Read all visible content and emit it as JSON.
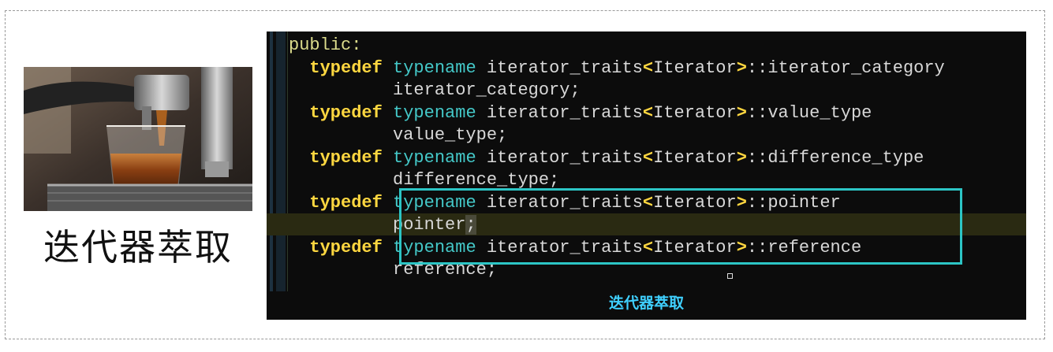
{
  "left_panel": {
    "photo_icon": "espresso-machine-photo",
    "title": "迭代器萃取"
  },
  "editor": {
    "lines": [
      [
        {
          "t": "public:",
          "c": "pub"
        }
      ],
      [
        {
          "t": "  ",
          "c": "id"
        },
        {
          "t": "typedef",
          "c": "kw"
        },
        {
          "t": " ",
          "c": "id"
        },
        {
          "t": "typename",
          "c": "tn"
        },
        {
          "t": " iterator_traits",
          "c": "id"
        },
        {
          "t": "<",
          "c": "br"
        },
        {
          "t": "Iterator",
          "c": "id"
        },
        {
          "t": ">",
          "c": "br"
        },
        {
          "t": "::iterator_category",
          "c": "id"
        }
      ],
      [
        {
          "t": "          iterator_category;",
          "c": "id"
        }
      ],
      [
        {
          "t": "  ",
          "c": "id"
        },
        {
          "t": "typedef",
          "c": "kw"
        },
        {
          "t": " ",
          "c": "id"
        },
        {
          "t": "typename",
          "c": "tn"
        },
        {
          "t": " iterator_traits",
          "c": "id"
        },
        {
          "t": "<",
          "c": "br"
        },
        {
          "t": "Iterator",
          "c": "id"
        },
        {
          "t": ">",
          "c": "br"
        },
        {
          "t": "::value_type",
          "c": "id"
        }
      ],
      [
        {
          "t": "          value_type;",
          "c": "id"
        }
      ],
      [
        {
          "t": "  ",
          "c": "id"
        },
        {
          "t": "typedef",
          "c": "kw"
        },
        {
          "t": " ",
          "c": "id"
        },
        {
          "t": "typename",
          "c": "tn"
        },
        {
          "t": " iterator_traits",
          "c": "id"
        },
        {
          "t": "<",
          "c": "br"
        },
        {
          "t": "Iterator",
          "c": "id"
        },
        {
          "t": ">",
          "c": "br"
        },
        {
          "t": "::difference_type",
          "c": "id"
        }
      ],
      [
        {
          "t": "          difference_type;",
          "c": "id"
        }
      ],
      [
        {
          "t": "  ",
          "c": "id"
        },
        {
          "t": "typedef",
          "c": "kw"
        },
        {
          "t": " ",
          "c": "id"
        },
        {
          "t": "typename",
          "c": "tn"
        },
        {
          "t": " iterator_traits",
          "c": "id"
        },
        {
          "t": "<",
          "c": "br"
        },
        {
          "t": "Iterator",
          "c": "id"
        },
        {
          "t": ">",
          "c": "br"
        },
        {
          "t": "::pointer",
          "c": "id"
        }
      ],
      [
        {
          "t": "          pointer",
          "c": "id"
        },
        {
          "t": ";",
          "c": "id semi-hl"
        }
      ],
      [
        {
          "t": "  ",
          "c": "id"
        },
        {
          "t": "typedef",
          "c": "kw"
        },
        {
          "t": " ",
          "c": "id"
        },
        {
          "t": "typename",
          "c": "tn"
        },
        {
          "t": " iterator_traits",
          "c": "id"
        },
        {
          "t": "<",
          "c": "br"
        },
        {
          "t": "Iterator",
          "c": "id"
        },
        {
          "t": ">",
          "c": "br"
        },
        {
          "t": "::reference",
          "c": "id"
        }
      ],
      [
        {
          "t": "          reference;",
          "c": "id"
        }
      ]
    ],
    "subtitle": "迭代器萃取",
    "colors": {
      "background": "#0c0c0c",
      "keyword": "#ffd740",
      "typename": "#44c8c8",
      "highlight_box": "#2cc5c5",
      "subtitle": "#3fd0ff"
    }
  }
}
